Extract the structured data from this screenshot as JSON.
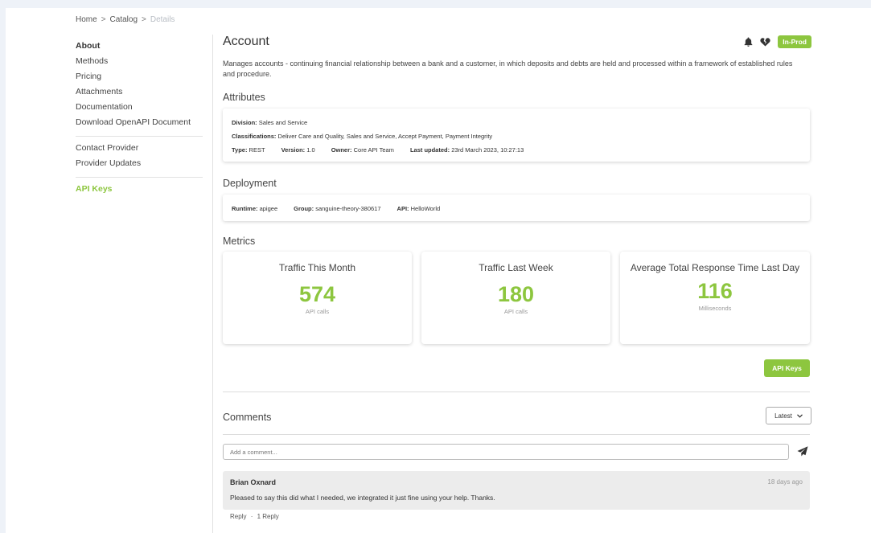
{
  "breadcrumb": {
    "home": "Home",
    "catalog": "Catalog",
    "current": "Details",
    "separator": ">"
  },
  "sidebar": {
    "items": [
      {
        "label": "About"
      },
      {
        "label": "Methods"
      },
      {
        "label": "Pricing"
      },
      {
        "label": "Attachments"
      },
      {
        "label": "Documentation"
      },
      {
        "label": "Download OpenAPI Document"
      }
    ],
    "items2": [
      {
        "label": "Contact Provider"
      },
      {
        "label": "Provider Updates"
      }
    ],
    "api_keys": "API Keys"
  },
  "header": {
    "title": "Account",
    "badge": "In-Prod",
    "description": "Manages accounts - continuing financial relationship between a bank and a customer, in which deposits and debts are held and processed within a framework of established rules and procedure."
  },
  "attributes": {
    "heading": "Attributes",
    "division_label": "Division:",
    "division": "Sales and Service",
    "classifications_label": "Classifications:",
    "classifications": "Deliver Care and Quality, Sales and Service, Accept Payment, Payment Integrity",
    "type_label": "Type:",
    "type": "REST",
    "version_label": "Version:",
    "version": "1.0",
    "owner_label": "Owner:",
    "owner": "Core API Team",
    "updated_label": "Last updated:",
    "updated": "23rd March 2023, 10:27:13"
  },
  "deployment": {
    "heading": "Deployment",
    "runtime_label": "Runtime:",
    "runtime": "apigee",
    "group_label": "Group:",
    "group": "sanguine-theory-380617",
    "api_label": "API:",
    "api": "HelloWorld"
  },
  "metrics": {
    "heading": "Metrics",
    "cards": [
      {
        "title": "Traffic This Month",
        "value": "574",
        "unit": "API calls"
      },
      {
        "title": "Traffic Last Week",
        "value": "180",
        "unit": "API calls"
      },
      {
        "title": "Average Total Response Time Last Day",
        "value": "116",
        "unit": "Milliseconds"
      }
    ]
  },
  "api_keys_button": "API Keys",
  "comments": {
    "heading": "Comments",
    "sort_value": "Latest",
    "input_placeholder": "Add a comment...",
    "items": [
      {
        "author": "Brian Oxnard",
        "time": "18 days ago",
        "text": "Pleased to say this did what I needed, we integrated it just fine using your help. Thanks.",
        "reply": "Reply",
        "dot": "·",
        "replies": "1 Reply"
      }
    ]
  },
  "colors": {
    "accent": "#8dc63f",
    "background": "#eef2f8"
  },
  "icons": [
    "bell-icon",
    "heart-broken-icon",
    "send-icon",
    "chevron-down-icon"
  ]
}
